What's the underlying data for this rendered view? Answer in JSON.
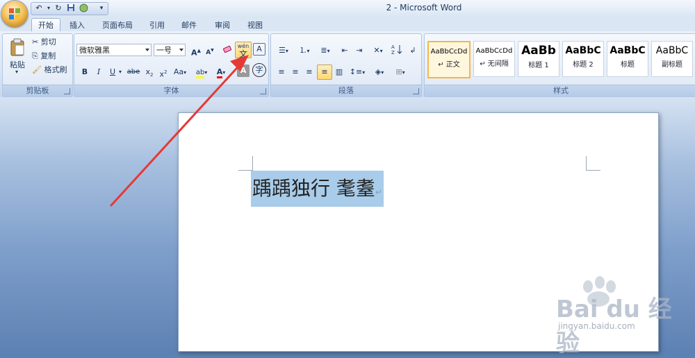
{
  "window": {
    "title": "2 - Microsoft Word"
  },
  "tabs": [
    "开始",
    "插入",
    "页面布局",
    "引用",
    "邮件",
    "审阅",
    "视图"
  ],
  "active_tab": "开始",
  "clipboard": {
    "paste_label": "粘贴",
    "cut_label": "剪切",
    "copy_label": "复制",
    "format_painter_label": "格式刷",
    "group_label": "剪贴板"
  },
  "font": {
    "font_name": "微软雅黑",
    "font_size": "一号",
    "group_label": "字体",
    "phonetic_guide_label": "wén\n文",
    "char_border_label": "A",
    "enclose_label": "字"
  },
  "paragraph": {
    "group_label": "段落"
  },
  "styles": {
    "group_label": "样式",
    "items": [
      {
        "sample": "AaBbCcDd",
        "label": "↵ 正文"
      },
      {
        "sample": "AaBbCcDd",
        "label": "↵ 无间隔"
      },
      {
        "sample": "AaBb",
        "label": "标题 1"
      },
      {
        "sample": "AaBbC",
        "label": "标题 2"
      },
      {
        "sample": "AaBbC",
        "label": "标题"
      },
      {
        "sample": "AaBbC",
        "label": "副标题"
      }
    ]
  },
  "document": {
    "selected_text": "踽踽独行 耄耋",
    "paragraph_mark": "↵"
  },
  "watermark": {
    "text": "Bai du 经验",
    "url": "jingyan.baidu.com"
  },
  "colors": {
    "highlight": "#a8cce9",
    "arrow": "#e53935",
    "selected_style_border": "#f3b74a"
  }
}
